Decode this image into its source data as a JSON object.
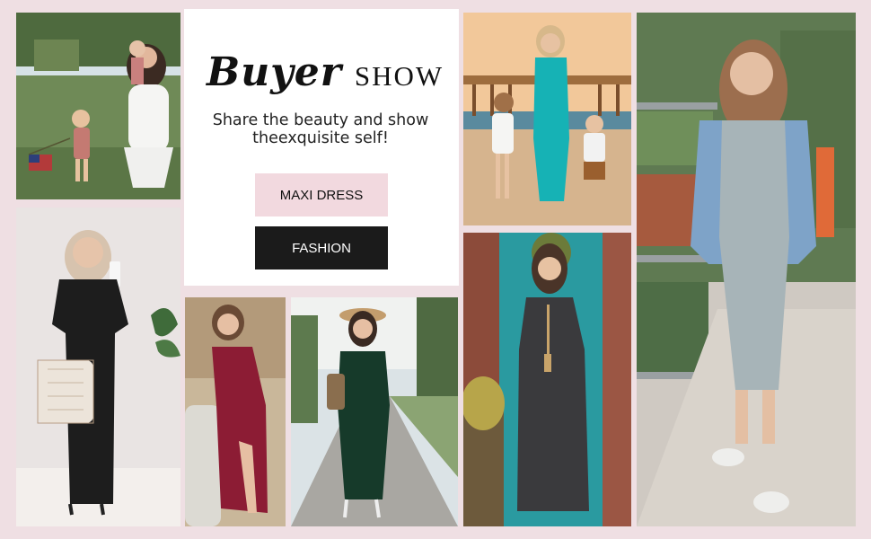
{
  "heading": {
    "script_text": "Buyer",
    "plain_text": "SHOW"
  },
  "tagline_line1": "Share the beauty and show",
  "tagline_line2": "theexquisite self!",
  "buttons": {
    "maxi_dress": "MAXI DRESS",
    "fashion": "FASHION"
  },
  "colors": {
    "background": "#efdfe3",
    "maxi_button": "#f2d9df",
    "fashion_button": "#1b1b1b"
  }
}
